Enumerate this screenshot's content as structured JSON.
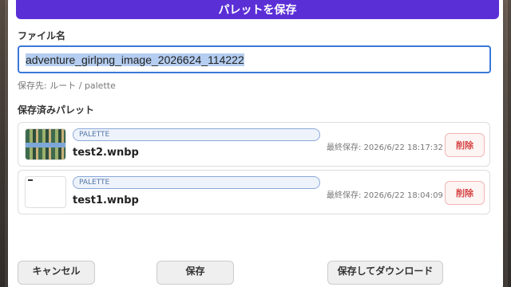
{
  "header": {
    "save_palette_label": "パレットを保存"
  },
  "file": {
    "label": "ファイル名",
    "value": "adventure_girlpng_image_2026624_114222",
    "destination": "保存先: ルート / palette"
  },
  "saved": {
    "label": "保存済みパレット",
    "items": [
      {
        "badge": "PALETTE",
        "name": "test2.wnbp",
        "saved_at": "最終保存: 2026/6/22 18:17:32",
        "delete_label": "削除"
      },
      {
        "badge": "PALETTE",
        "name": "test1.wnbp",
        "saved_at": "最終保存: 2026/6/22 18:04:09",
        "delete_label": "削除"
      }
    ]
  },
  "footer": {
    "cancel_label": "キャンセル",
    "save_label": "保存",
    "save_download_label": "保存してダウンロード"
  },
  "colors": {
    "accent": "#5b2fd6",
    "danger": "#d64545",
    "focus": "#3b78d8"
  }
}
